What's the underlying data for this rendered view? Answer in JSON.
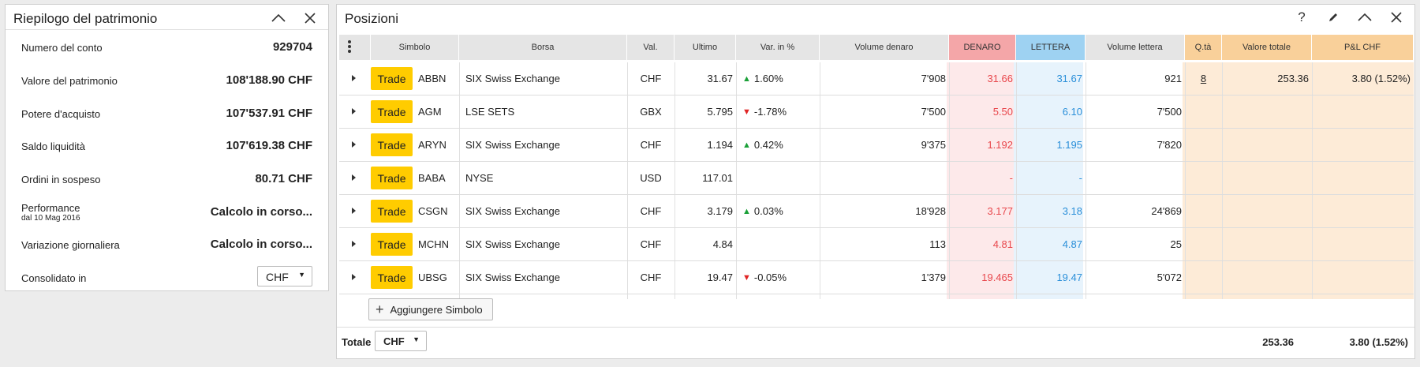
{
  "summary": {
    "title": "Riepilogo del patrimonio",
    "rows": [
      {
        "label": "Numero del conto",
        "value": "929704"
      },
      {
        "label": "Valore del patrimonio",
        "value": "108'188.90 CHF"
      },
      {
        "label": "Potere d'acquisto",
        "value": "107'537.91 CHF"
      },
      {
        "label": "Saldo liquidità",
        "value": "107'619.38 CHF"
      },
      {
        "label": "Ordini in sospeso",
        "value": "80.71 CHF"
      },
      {
        "label": "Performance",
        "sublabel": "dal 10 Mag 2016",
        "value": "Calcolo in corso..."
      },
      {
        "label": "Variazione giornaliera",
        "value": "Calcolo in corso..."
      }
    ],
    "consolidated_label": "Consolidato in",
    "consolidated_value": "CHF"
  },
  "positions": {
    "title": "Posizioni",
    "help": "?",
    "columns": [
      "Simbolo",
      "Borsa",
      "Val.",
      "Ultimo",
      "Var. in %",
      "Volume denaro",
      "DENARO",
      "LETTERA",
      "Volume lettera",
      "Q.tà",
      "Valore totale",
      "P&L CHF"
    ],
    "trade_label": "Trade",
    "rows": [
      {
        "symbol": "ABBN",
        "exchange": "SIX Swiss Exchange",
        "currency": "CHF",
        "last": "31.67",
        "dir": "up",
        "change": "1.60%",
        "bid_vol": "7'908",
        "bid": "31.66",
        "ask": "31.67",
        "ask_vol": "921",
        "qty": "8",
        "total": "253.36",
        "pl": "3.80 (1.52%)"
      },
      {
        "symbol": "AGM",
        "exchange": "LSE SETS",
        "currency": "GBX",
        "last": "5.795",
        "dir": "down",
        "change": "-1.78%",
        "bid_vol": "7'500",
        "bid": "5.50",
        "ask": "6.10",
        "ask_vol": "7'500",
        "qty": "",
        "total": "",
        "pl": ""
      },
      {
        "symbol": "ARYN",
        "exchange": "SIX Swiss Exchange",
        "currency": "CHF",
        "last": "1.194",
        "dir": "up",
        "change": "0.42%",
        "bid_vol": "9'375",
        "bid": "1.192",
        "ask": "1.195",
        "ask_vol": "7'820",
        "qty": "",
        "total": "",
        "pl": ""
      },
      {
        "symbol": "BABA",
        "exchange": "NYSE",
        "currency": "USD",
        "last": "117.01",
        "dir": "",
        "change": "",
        "bid_vol": "",
        "bid": "-",
        "ask": "-",
        "ask_vol": "",
        "qty": "",
        "total": "",
        "pl": ""
      },
      {
        "symbol": "CSGN",
        "exchange": "SIX Swiss Exchange",
        "currency": "CHF",
        "last": "3.179",
        "dir": "up",
        "change": "0.03%",
        "bid_vol": "18'928",
        "bid": "3.177",
        "ask": "3.18",
        "ask_vol": "24'869",
        "qty": "",
        "total": "",
        "pl": ""
      },
      {
        "symbol": "MCHN",
        "exchange": "SIX Swiss Exchange",
        "currency": "CHF",
        "last": "4.84",
        "dir": "",
        "change": "",
        "bid_vol": "113",
        "bid": "4.81",
        "ask": "4.87",
        "ask_vol": "25",
        "qty": "",
        "total": "",
        "pl": ""
      },
      {
        "symbol": "UBSG",
        "exchange": "SIX Swiss Exchange",
        "currency": "CHF",
        "last": "19.47",
        "dir": "down",
        "change": "-0.05%",
        "bid_vol": "1'379",
        "bid": "19.465",
        "ask": "19.47",
        "ask_vol": "5'072",
        "qty": "",
        "total": "",
        "pl": ""
      }
    ],
    "add_symbol": "Aggiungere Simbolo",
    "total_label": "Totale",
    "total_currency": "CHF",
    "total_value": "253.36",
    "total_pl": "3.80 (1.52%)"
  },
  "colors": {
    "trade": "#ffcc00",
    "bid": "#e8474c",
    "ask": "#2a8fd9",
    "up": "#1aa038",
    "down": "#e02525"
  }
}
